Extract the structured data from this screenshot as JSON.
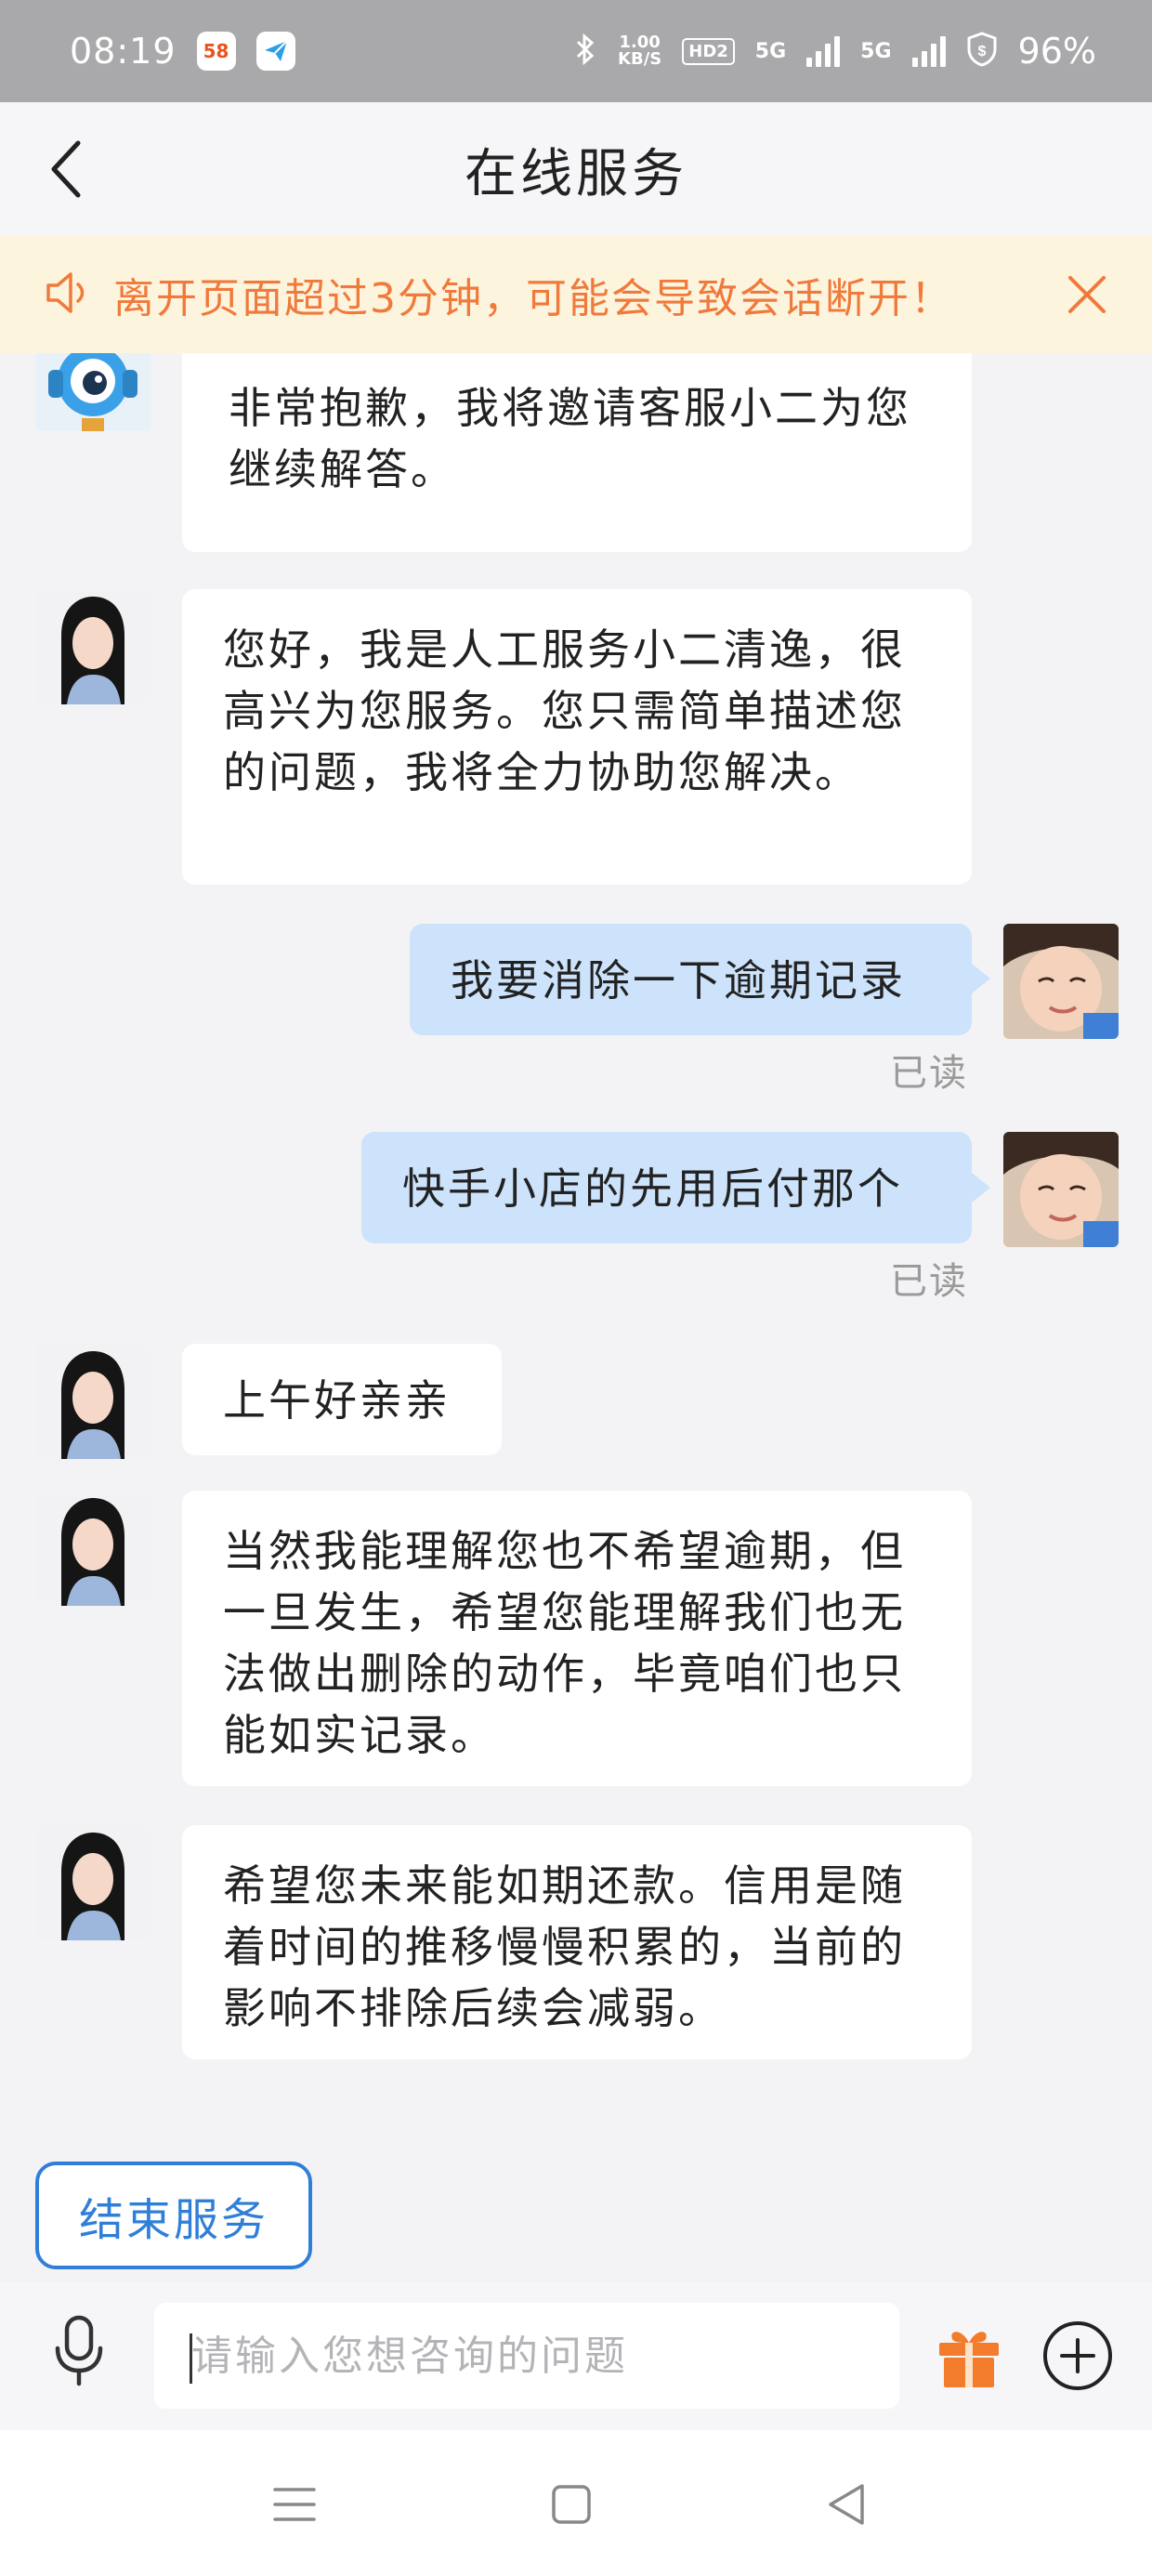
{
  "status_bar": {
    "time": "08:19",
    "app_badges": [
      "58",
      "plane"
    ],
    "speed_value": "1.00",
    "speed_unit": "KB/S",
    "hd_label": "HD2",
    "net1_label": "5G",
    "net2_label": "5G",
    "battery": "96%"
  },
  "header": {
    "title": "在线服务"
  },
  "notice": {
    "text": "离开页面超过3分钟，可能会导致会话断开！",
    "color": "#f07a3b"
  },
  "messages": [
    {
      "side": "left",
      "sender": "bot",
      "text": "非常抱歉，我将邀请客服小二为您继续解答。"
    },
    {
      "side": "left",
      "sender": "agent",
      "text": "您好，我是人工服务小二清逸，很高兴为您服务。您只需简单描述您的问题，我将全力协助您解决。"
    },
    {
      "side": "right",
      "sender": "user",
      "text": "我要消除一下逾期记录",
      "status": "已读"
    },
    {
      "side": "right",
      "sender": "user",
      "text": "快手小店的先用后付那个",
      "status": "已读"
    },
    {
      "side": "left",
      "sender": "agent",
      "text": "上午好亲亲"
    },
    {
      "side": "left",
      "sender": "agent",
      "text": "当然我能理解您也不希望逾期，但一旦发生，希望您能理解我们也无法做出删除的动作，毕竟咱们也只能如实记录。"
    },
    {
      "side": "left",
      "sender": "agent",
      "text": "希望您未来能如期还款。信用是随着时间的推移慢慢积累的，当前的影响不排除后续会减弱。"
    }
  ],
  "end_service_label": "结束服务",
  "input": {
    "placeholder": "请输入您想咨询的问题",
    "value": ""
  },
  "icons": {
    "back": "chevron-left-icon",
    "notice": "speaker-icon",
    "close": "close-icon",
    "mic": "microphone-icon",
    "gift": "gift-icon",
    "plus": "plus-circle-icon"
  },
  "colors": {
    "accent": "#2f7fd9",
    "user_bubble": "#cce3fb",
    "notice_bg": "#fdf4dd",
    "gift": "#f37b2c"
  }
}
